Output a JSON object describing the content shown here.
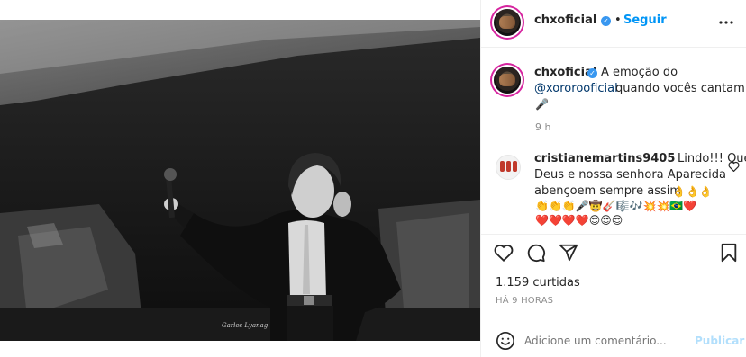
{
  "post": {
    "username": "chxoficial",
    "follow_label": "Seguir",
    "more_icon": "more-horizontal-icon",
    "photo_signature": "Garlos Lyanag"
  },
  "caption": {
    "username": "chxoficial",
    "text_part1": "A emoção do",
    "mention": "@xororooficial",
    "text_part2": "quando vocês cantam!",
    "emoji": "🎤",
    "time": "9 h"
  },
  "comment": {
    "username": "cristianemartins9405",
    "text_line1": "Lindo!!! Que",
    "text_line2": "Deus e nossa senhora Aparecida",
    "text_line3": "abençoem sempre assim",
    "emojis_line3": "👌👌👌",
    "emojis_line4": "👏👏👏🎤🤠🎸🎼🎶💥💥🇧🇷❤️",
    "emojis_line5": "❤️❤️❤️❤️😍😍😍"
  },
  "actions": {
    "likes": "1.159 curtidas",
    "timestamp": "HÁ 9 HORAS"
  },
  "add_comment": {
    "placeholder": "Adicione um comentário...",
    "publish_label": "Publicar"
  },
  "colors": {
    "accent": "#0095f6",
    "verified": "#3897f0",
    "story_ring": "#d6249f"
  }
}
